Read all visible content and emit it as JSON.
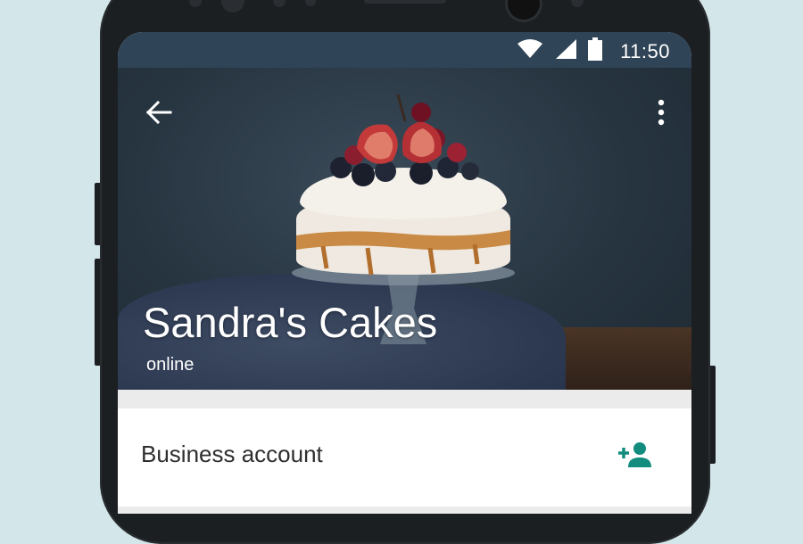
{
  "status_bar": {
    "time": "11:50",
    "icons": [
      "wifi-icon",
      "signal-icon",
      "battery-icon"
    ]
  },
  "header": {
    "back_icon": "arrow-left-icon",
    "menu_icon": "more-vertical-icon",
    "title": "Sandra's Cakes",
    "subtitle": "online"
  },
  "info_card": {
    "label": "Business account",
    "action_icon": "add-contact-icon"
  },
  "colors": {
    "status_bar": "#2f4456",
    "accent": "#128c7e",
    "background": "#d3e6ea"
  }
}
